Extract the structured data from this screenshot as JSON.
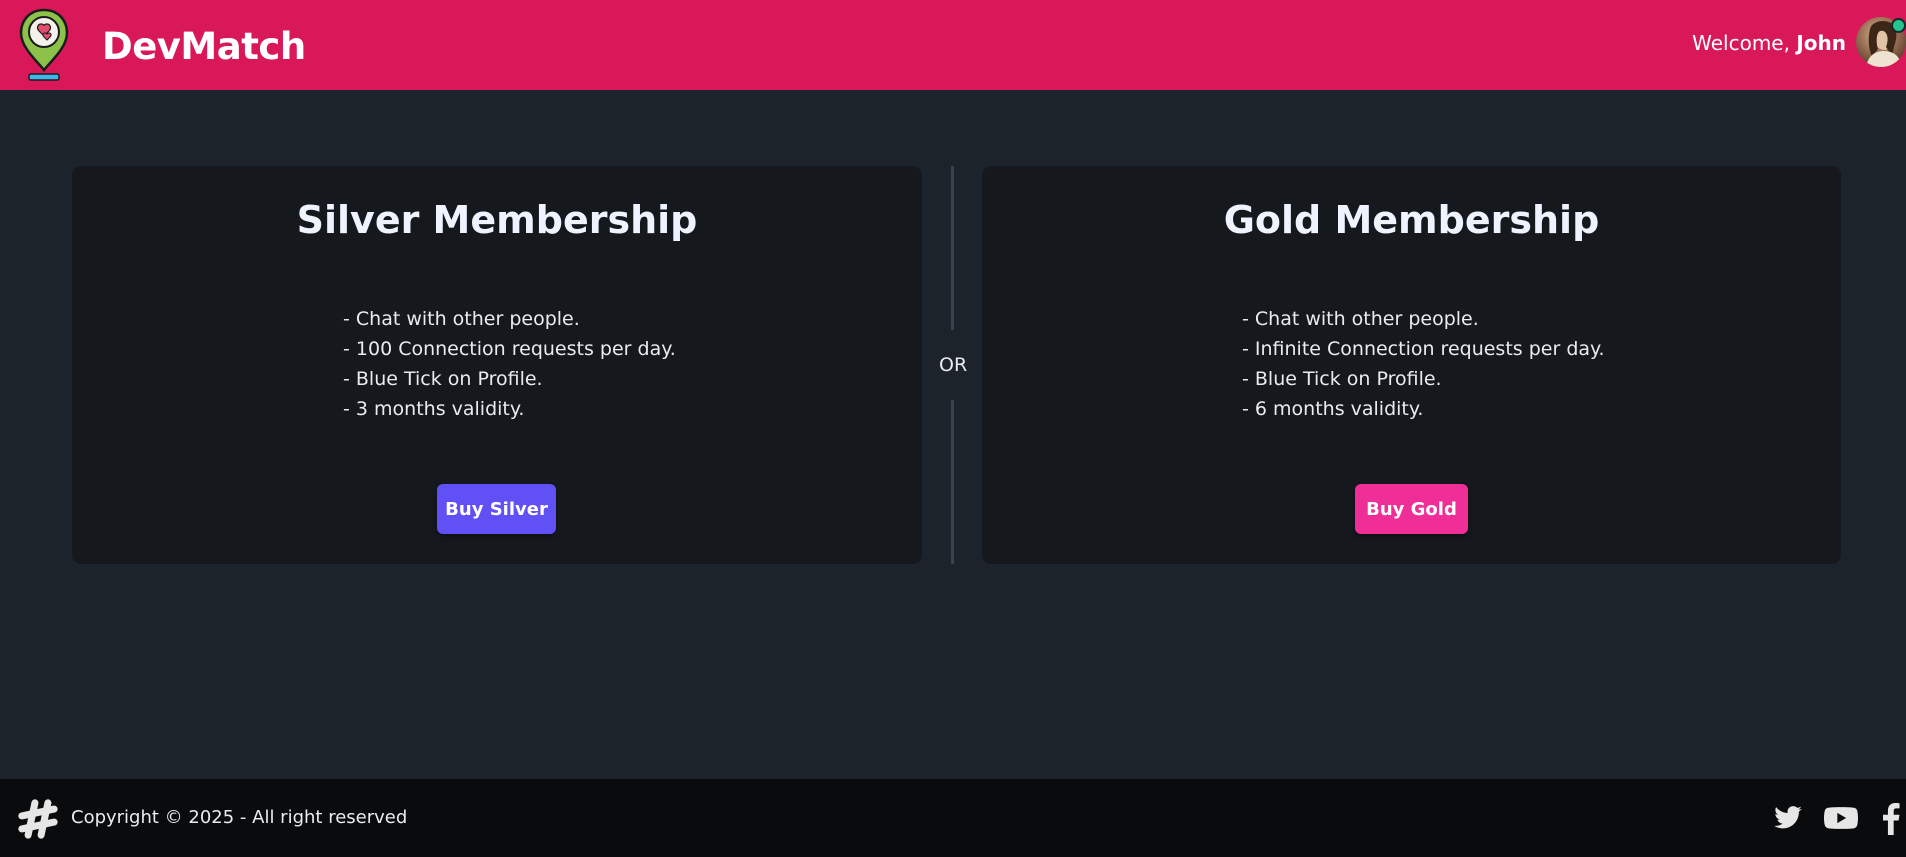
{
  "navbar": {
    "brand": "DevMatch",
    "welcome_prefix": "Welcome,",
    "user_name": "John"
  },
  "plans": [
    {
      "title": "Silver Membership",
      "features": [
        "- Chat with other people.",
        "- 100 Connection requests per day.",
        "- Blue Tick on Profile.",
        "- 3 months validity."
      ],
      "button_label": "Buy Silver",
      "button_color": "#6150f5"
    },
    {
      "title": "Gold Membership",
      "features": [
        "- Chat with other people.",
        "- Infinite Connection requests per day.",
        "- Blue Tick on Profile.",
        "- 6 months validity."
      ],
      "button_label": "Buy Gold",
      "button_color": "#ef2f97"
    }
  ],
  "divider_text": "OR",
  "footer": {
    "copyright": "Copyright © 2025 - All right reserved",
    "social_icons": [
      "twitter-icon",
      "youtube-icon",
      "facebook-icon"
    ]
  },
  "colors": {
    "brand": "#d9185a",
    "background": "#1d232a",
    "card": "#15191e",
    "footer": "#0a0b0c",
    "online": "#23c48e"
  }
}
